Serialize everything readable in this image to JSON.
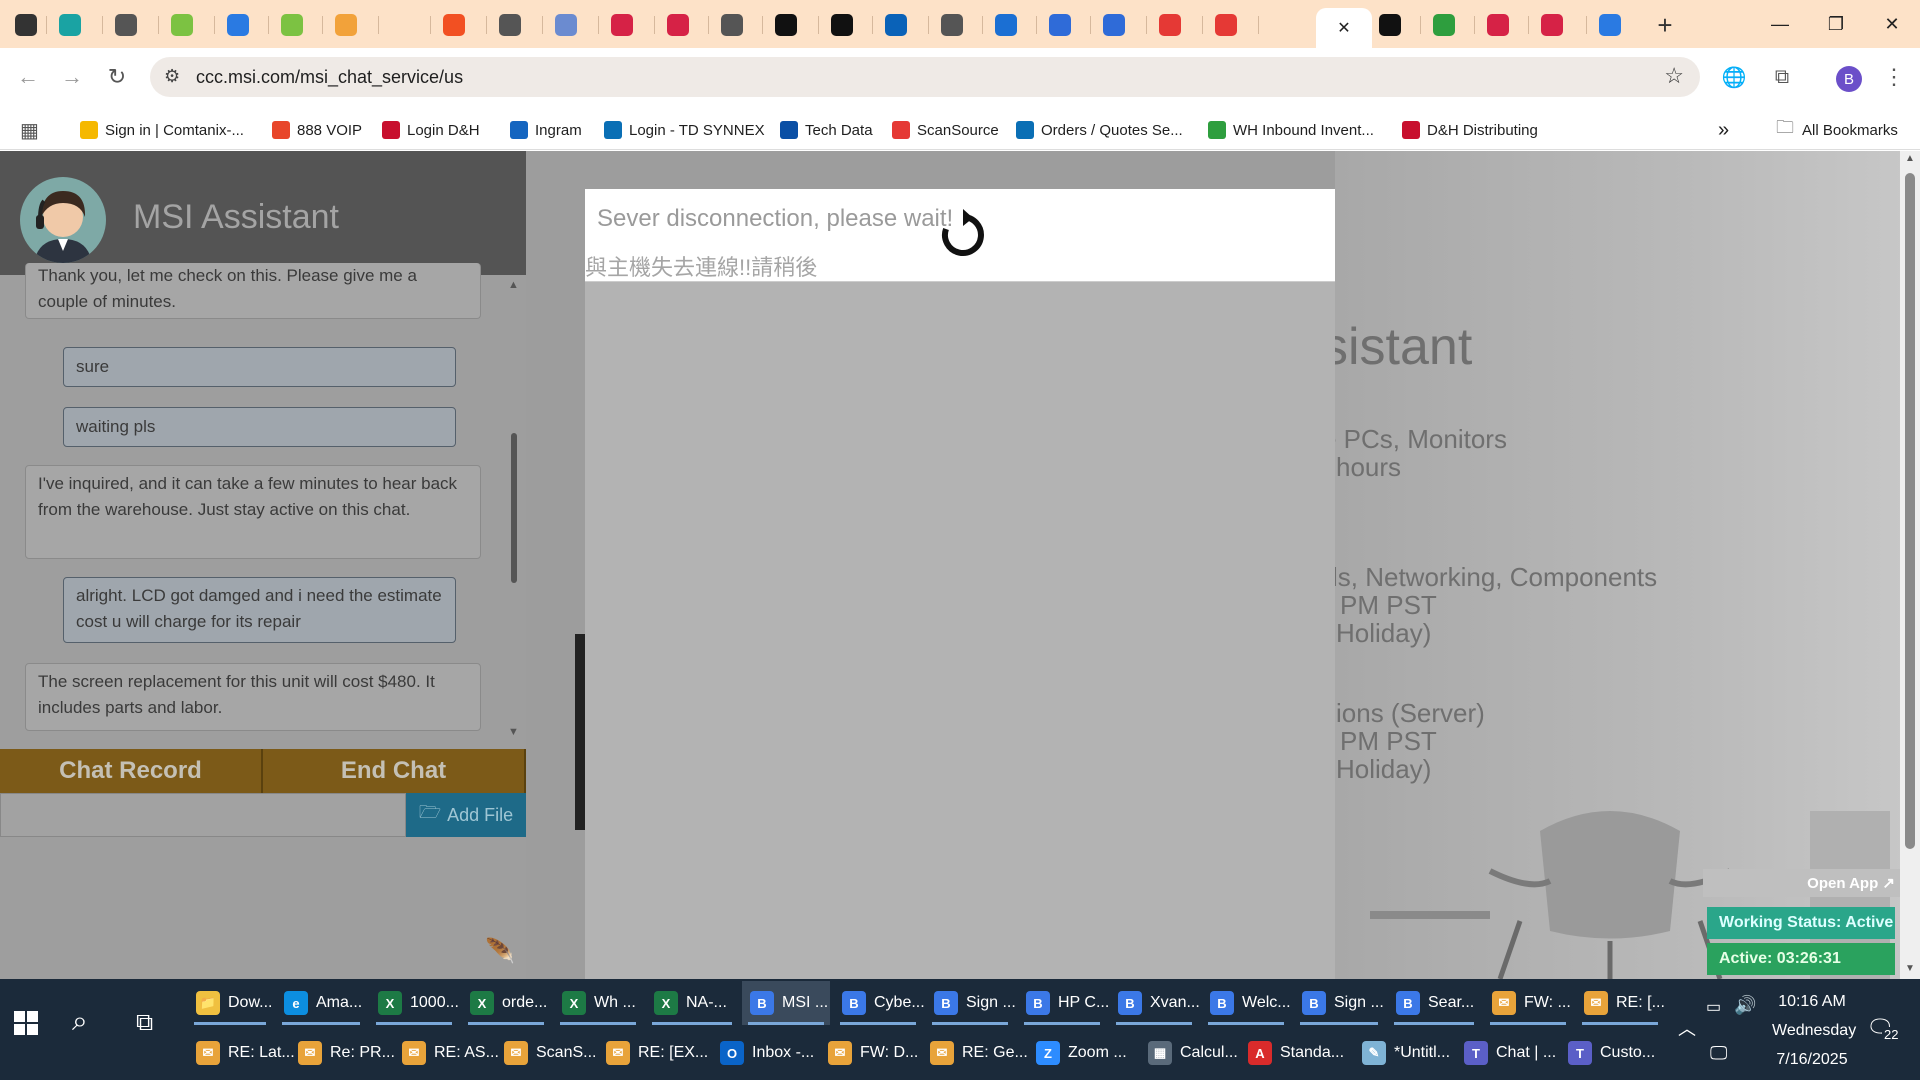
{
  "browser": {
    "tabs": [
      {
        "icon": "chrome-dropdown-icon",
        "color": "#333"
      },
      {
        "icon": "teal-app-icon",
        "color": "#1aa3a3"
      },
      {
        "icon": "settings-globe-icon",
        "color": "#555"
      },
      {
        "icon": "green-a-icon",
        "color": "#7cc242"
      },
      {
        "icon": "safari-icon",
        "color": "#2a7ae2"
      },
      {
        "icon": "green-a-icon",
        "color": "#7cc242"
      },
      {
        "icon": "orange-icon",
        "color": "#f2a23a"
      },
      {
        "icon": "blank-icon",
        "color": "#fde2c8"
      },
      {
        "icon": "microsoft-icon",
        "color": "#f25022"
      },
      {
        "icon": "globe-icon",
        "color": "#555"
      },
      {
        "icon": "document-icon",
        "color": "#6b8bd0"
      },
      {
        "icon": "red-arrow-icon",
        "color": "#d62246"
      },
      {
        "icon": "red-arrow-icon",
        "color": "#d62246"
      },
      {
        "icon": "globe-icon",
        "color": "#555"
      },
      {
        "icon": "s-icon",
        "color": "#111"
      },
      {
        "icon": "s-icon",
        "color": "#111"
      },
      {
        "icon": "hp-icon",
        "color": "#0a62b8"
      },
      {
        "icon": "globe-icon",
        "color": "#555"
      },
      {
        "icon": "blue-chevron-icon",
        "color": "#1b6fd3"
      },
      {
        "icon": "a-logo-icon",
        "color": "#2f6bd8"
      },
      {
        "icon": "a-logo-icon",
        "color": "#2f6bd8"
      },
      {
        "icon": "shield-icon",
        "color": "#e53935"
      },
      {
        "icon": "shield-icon",
        "color": "#e53935"
      },
      {
        "icon": "blank-icon",
        "color": "#fde2c8"
      },
      {
        "icon": "msi-icon",
        "color": "#111"
      },
      {
        "icon": "green-screen-icon",
        "color": "#2e9e3e"
      },
      {
        "icon": "red-arrow-icon",
        "color": "#d62246"
      },
      {
        "icon": "red-arrow-icon",
        "color": "#d62246"
      },
      {
        "icon": "chevron-circle-icon",
        "color": "#2a7ae2"
      }
    ],
    "active_tab_close": "✕",
    "new_tab": "+",
    "url": "ccc.msi.com/msi_chat_service/us",
    "profile_initial": "B",
    "bookmarks": [
      {
        "label": "Sign in | Comtanix-...",
        "color": "#f5b800"
      },
      {
        "label": "888 VOIP",
        "color": "#e8462a"
      },
      {
        "label": "Login D&H",
        "color": "#c8102e"
      },
      {
        "label": "Ingram",
        "color": "#1565c0"
      },
      {
        "label": "Login - TD SYNNEX",
        "color": "#0a6fb5"
      },
      {
        "label": "Tech Data",
        "color": "#0a4fa5"
      },
      {
        "label": "ScanSource",
        "color": "#e53935"
      },
      {
        "label": "Orders / Quotes Se...",
        "color": "#0a6fb5"
      },
      {
        "label": "WH Inbound Invent...",
        "color": "#2e9e3e"
      },
      {
        "label": "D&H Distributing",
        "color": "#c8102e"
      }
    ],
    "all_bookmarks": "All Bookmarks"
  },
  "chat": {
    "title": "MSI Assistant",
    "messages": [
      {
        "from": "agent",
        "text": "Thank you, let me check on this. Please give me a couple of minutes."
      },
      {
        "from": "user",
        "text": "sure"
      },
      {
        "from": "user",
        "text": "waiting pls"
      },
      {
        "from": "agent",
        "text": "I've inquired, and it can take a few minutes to hear back from the warehouse. Just stay active on this chat."
      },
      {
        "from": "user",
        "text": "alright. LCD got damged and i need the estimate cost u will charge for its repair"
      },
      {
        "from": "agent",
        "text": "The screen replacement for this unit will cost $480. It includes parts and labor."
      }
    ],
    "chat_record_label": "Chat Record",
    "end_chat_label": "End Chat",
    "add_file_label": "Add File"
  },
  "background": {
    "lines": [
      "sistant",
      "e PCs, Monitors",
      "hours",
      "ls, Networking, Components",
      "PM PST",
      "Holiday)",
      "ions (Server)",
      "PM PST",
      "Holiday)"
    ]
  },
  "modal": {
    "message_en": "Sever disconnection, please wait!",
    "message_zh": "與主機失去連線!!請稍後"
  },
  "status_widget": {
    "open_app": "Open App ↗",
    "working_status": "Working Status: Active",
    "active_timer": "Active: 03:26:31"
  },
  "taskbar": {
    "row1": [
      {
        "label": "Dow...",
        "color": "#f0c040",
        "glyph": "📁"
      },
      {
        "label": "Ama...",
        "color": "#0c8ee0",
        "glyph": "e"
      },
      {
        "label": "1000...",
        "color": "#1d7a45",
        "glyph": "X"
      },
      {
        "label": "orde...",
        "color": "#1d7a45",
        "glyph": "X"
      },
      {
        "label": "Wh ...",
        "color": "#1d7a45",
        "glyph": "X"
      },
      {
        "label": "NA-...",
        "color": "#1d7a45",
        "glyph": "X"
      },
      {
        "label": "MSI ...",
        "color": "#3b78e7",
        "glyph": "B"
      },
      {
        "label": "Cybe...",
        "color": "#3b78e7",
        "glyph": "B"
      },
      {
        "label": "Sign ...",
        "color": "#3b78e7",
        "glyph": "B"
      },
      {
        "label": "HP C...",
        "color": "#3b78e7",
        "glyph": "B"
      },
      {
        "label": "Xvan...",
        "color": "#3b78e7",
        "glyph": "B"
      },
      {
        "label": "Welc...",
        "color": "#3b78e7",
        "glyph": "B"
      },
      {
        "label": "Sign ...",
        "color": "#3b78e7",
        "glyph": "B"
      },
      {
        "label": "Sear...",
        "color": "#3b78e7",
        "glyph": "B"
      },
      {
        "label": "FW: ...",
        "color": "#e8a33a",
        "glyph": "✉"
      },
      {
        "label": "RE: [...",
        "color": "#e8a33a",
        "glyph": "✉"
      }
    ],
    "row2": [
      {
        "label": "RE: Lat...",
        "color": "#e8a33a",
        "glyph": "✉"
      },
      {
        "label": "Re: PR...",
        "color": "#e8a33a",
        "glyph": "✉"
      },
      {
        "label": "RE: AS...",
        "color": "#e8a33a",
        "glyph": "✉"
      },
      {
        "label": "ScanS...",
        "color": "#e8a33a",
        "glyph": "✉"
      },
      {
        "label": "RE: [EX...",
        "color": "#e8a33a",
        "glyph": "✉"
      },
      {
        "label": "Inbox -...",
        "color": "#0a64c8",
        "glyph": "O"
      },
      {
        "label": "FW: D...",
        "color": "#e8a33a",
        "glyph": "✉"
      },
      {
        "label": "RE: Ge...",
        "color": "#e8a33a",
        "glyph": "✉"
      },
      {
        "label": "Zoom ...",
        "color": "#2d8cff",
        "glyph": "Z"
      },
      {
        "label": "Calcul...",
        "color": "#5a6a7a",
        "glyph": "▦"
      },
      {
        "label": "Standa...",
        "color": "#d92b2b",
        "glyph": "A"
      },
      {
        "label": "*Untitl...",
        "color": "#7fb3d5",
        "glyph": "✎"
      },
      {
        "label": "Chat | ...",
        "color": "#5b5fc7",
        "glyph": "T"
      },
      {
        "label": "Custo...",
        "color": "#5b5fc7",
        "glyph": "T"
      }
    ],
    "time": "10:16 AM",
    "day": "Wednesday",
    "date": "7/16/2025",
    "notification_count": "22"
  }
}
